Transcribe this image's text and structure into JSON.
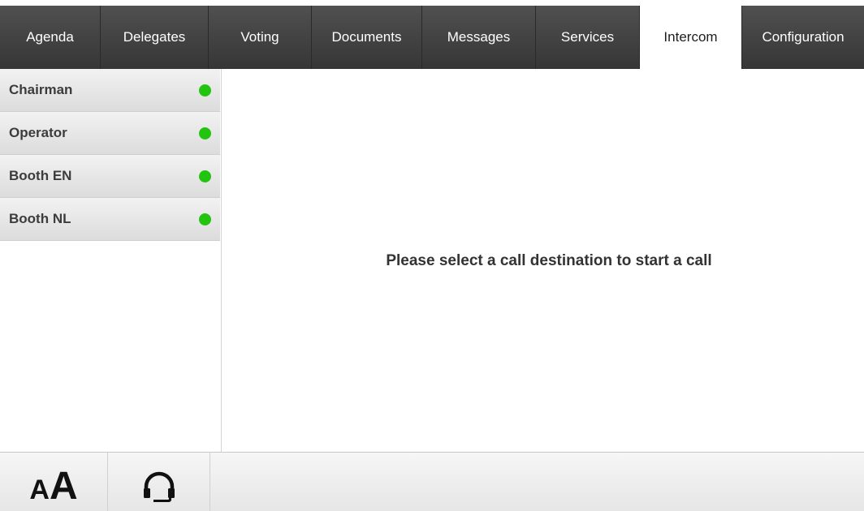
{
  "tabs": [
    {
      "label": "Agenda",
      "active": false
    },
    {
      "label": "Delegates",
      "active": false
    },
    {
      "label": "Voting",
      "active": false
    },
    {
      "label": "Documents",
      "active": false
    },
    {
      "label": "Messages",
      "active": false
    },
    {
      "label": "Services",
      "active": false
    },
    {
      "label": "Intercom",
      "active": true
    },
    {
      "label": "Configuration",
      "active": false
    }
  ],
  "destinations": [
    {
      "label": "Chairman",
      "status": "online"
    },
    {
      "label": "Operator",
      "status": "online"
    },
    {
      "label": "Booth EN",
      "status": "online"
    },
    {
      "label": "Booth NL",
      "status": "online"
    }
  ],
  "main": {
    "prompt": "Please select a call destination to start a call"
  },
  "bottombar": {
    "font_size_icon_small": "A",
    "font_size_icon_big": "A",
    "font_size_icon_name": "font-size-icon",
    "headset_icon_name": "headset-icon"
  },
  "colors": {
    "tabbar_top": "#505050",
    "tabbar_bottom": "#363636",
    "status_online": "#22c40f",
    "active_tab_bg": "#ffffff"
  }
}
